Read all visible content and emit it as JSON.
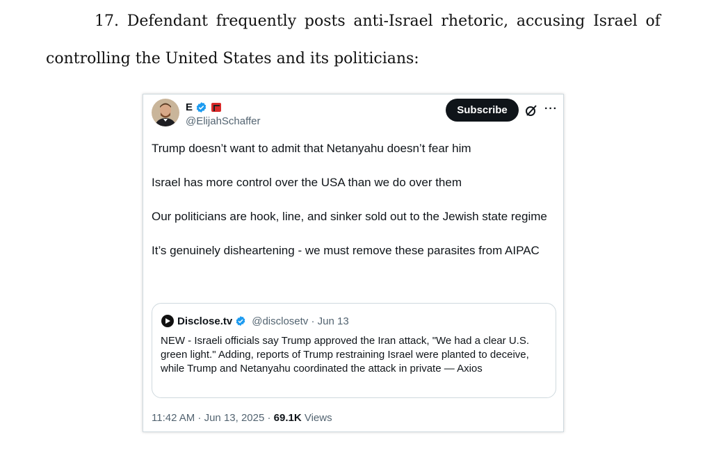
{
  "document": {
    "paragraph_number": "17.",
    "line1_words": [
      "Defendant",
      "frequently",
      "posts",
      "anti-Israel",
      "rhetoric,",
      "accusing",
      "Israel",
      "of"
    ],
    "line2": "controlling the United States and its politicians:"
  },
  "tweet": {
    "display_name": "E",
    "handle": "@ElijahSchaffer",
    "subscribe_label": "Subscribe",
    "more_label": "···",
    "paragraphs": [
      "Trump doesn’t want to admit that Netanyahu doesn’t fear him",
      "Israel has more control over the USA than we do over them",
      "Our politicians are hook, line, and sinker sold out to the Jewish state regime",
      "It’s genuinely disheartening - we must remove these parasites from AIPAC"
    ],
    "quote": {
      "name": "Disclose.tv",
      "handle_date": "@disclosetv · Jun 13",
      "text": "NEW - Israeli officials say Trump approved the Iran attack, \"We had a clear U.S. green light.\" Adding, reports of Trump restraining Israel were planted to deceive, while Trump and Netanyahu coordinated the attack in private — Axios"
    },
    "footer": {
      "timestamp": "11:42 AM · Jun 13, 2025 · ",
      "views_count": "69.1K",
      "views_label": " Views"
    }
  },
  "colors": {
    "verified": "#1d9bf0",
    "badge_red": "#d92a2a",
    "subscribe_bg": "#0f1419"
  },
  "icons": [
    "verified-badge-icon",
    "affiliate-badge-icon",
    "grok-icon",
    "more-icon",
    "disclose-logo-icon"
  ]
}
